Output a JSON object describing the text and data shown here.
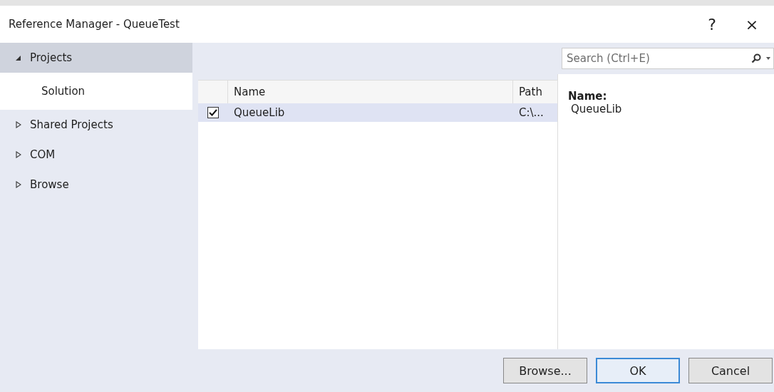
{
  "window": {
    "title": "Reference Manager - QueueTest",
    "help": "?",
    "close": "×"
  },
  "sidebar": {
    "items": [
      {
        "label": "Projects",
        "expanded": true,
        "selected": false,
        "children": [
          {
            "label": "Solution",
            "selected": true
          }
        ]
      },
      {
        "label": "Shared Projects",
        "expanded": false,
        "selected": false
      },
      {
        "label": "COM",
        "expanded": false,
        "selected": false
      },
      {
        "label": "Browse",
        "expanded": false,
        "selected": false
      }
    ]
  },
  "search": {
    "placeholder": "Search (Ctrl+E)"
  },
  "table": {
    "columns": [
      "Name",
      "Path"
    ],
    "rows": [
      {
        "checked": true,
        "selected": true,
        "cells": [
          "QueueLib",
          "C:\\..."
        ]
      }
    ]
  },
  "details": {
    "label": "Name:",
    "value": "QueueLib"
  },
  "buttons": [
    {
      "label": "Browse...",
      "default": false
    },
    {
      "label": "OK",
      "default": true
    },
    {
      "label": "Cancel",
      "default": false
    }
  ]
}
